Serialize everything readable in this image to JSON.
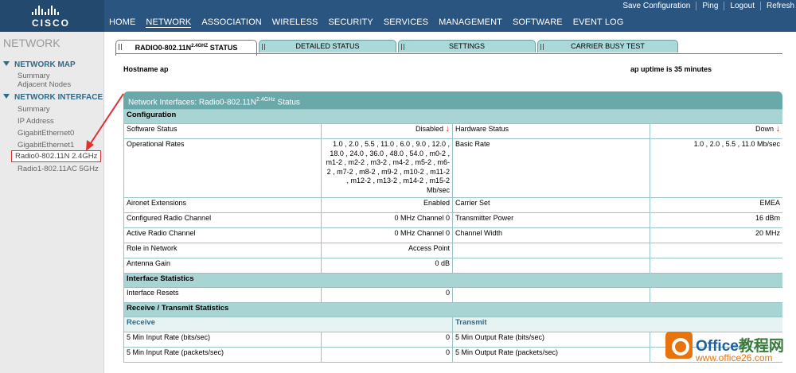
{
  "brand": {
    "logo_text": "CISCO"
  },
  "utility_links": [
    "Save Configuration",
    "Ping",
    "Logout",
    "Refresh"
  ],
  "nav": {
    "items": [
      "HOME",
      "NETWORK",
      "ASSOCIATION",
      "WIRELESS",
      "SECURITY",
      "SERVICES",
      "MANAGEMENT",
      "SOFTWARE",
      "EVENT LOG"
    ],
    "active": "NETWORK"
  },
  "sidebar": {
    "title": "NETWORK",
    "network_map": {
      "label": "NETWORK MAP",
      "items": [
        "Summary",
        "Adjacent Nodes"
      ]
    },
    "network_interface": {
      "label": "NETWORK INTERFACE",
      "items": [
        "Summary",
        "IP Address",
        "GigabitEthernet0",
        "GigabitEthernet1",
        "Radio0-802.11N 2.4GHz",
        "Radio1-802.11AC 5GHz"
      ],
      "selected": "Radio0-802.11N 2.4GHz"
    }
  },
  "tabs": {
    "status": {
      "main": "RADIO0-802.11N",
      "sup": "2.4GHZ",
      "rest": " STATUS"
    },
    "detailed": "DETAILED STATUS",
    "settings": "SETTINGS",
    "carrier": "CARRIER BUSY TEST"
  },
  "info": {
    "hostname": "Hostname  ap",
    "uptime": "ap uptime is 35 minutes"
  },
  "panel": {
    "title_main": "Network Interfaces: Radio0-802.11N",
    "title_sup": "2.4GHz",
    "title_rest": " Status"
  },
  "sections": {
    "configuration": "Configuration",
    "interface_stats": "Interface Statistics",
    "rx_tx": "Receive / Transmit Statistics",
    "receive": "Receive",
    "transmit": "Transmit"
  },
  "config": {
    "software_status": {
      "label": "Software Status",
      "value": "Disabled",
      "arrow": "↓"
    },
    "hardware_status": {
      "label": "Hardware Status",
      "value": "Down",
      "arrow": "↓"
    },
    "operational_rates": {
      "label": "Operational Rates",
      "value": "1.0 , 2.0 , 5.5 , 11.0 , 6.0 , 9.0 , 12.0 , 18.0 , 24.0 , 36.0 , 48.0 , 54.0 , m0-2 , m1-2 , m2-2 , m3-2 , m4-2 , m5-2 , m6-2 , m7-2 , m8-2 , m9-2 , m10-2 , m11-2 , m12-2 , m13-2 , m14-2 , m15-2 Mb/sec"
    },
    "basic_rate": {
      "label": "Basic Rate",
      "value": "1.0 , 2.0 , 5.5 , 11.0 Mb/sec"
    },
    "aironet": {
      "label": "Aironet Extensions",
      "value": "Enabled"
    },
    "carrier_set": {
      "label": "Carrier Set",
      "value": "EMEA"
    },
    "configured_channel": {
      "label": "Configured Radio Channel",
      "value": "0 MHz Channel 0"
    },
    "tx_power": {
      "label": "Transmitter Power",
      "value": "16 dBm"
    },
    "active_channel": {
      "label": "Active Radio Channel",
      "value": "0 MHz Channel 0"
    },
    "channel_width": {
      "label": "Channel Width",
      "value": "20 MHz"
    },
    "role": {
      "label": "Role in Network",
      "value": "Access Point"
    },
    "antenna_gain": {
      "label": "Antenna Gain",
      "value": "0 dB"
    }
  },
  "interface_stats": {
    "resets": {
      "label": "Interface Resets",
      "value": "0"
    }
  },
  "rx_tx": {
    "in_bits": {
      "label": "5 Min Input Rate (bits/sec)",
      "value": "0"
    },
    "in_pkts": {
      "label": "5 Min Input Rate (packets/sec)",
      "value": "0"
    },
    "out_bits": {
      "label": "5 Min Output Rate (bits/sec)",
      "value": ""
    },
    "out_pkts": {
      "label": "5 Min Output Rate (packets/sec)",
      "value": ""
    }
  },
  "watermark": {
    "brand": "Office",
    "brand2": "教程网",
    "url": "www.office26.com"
  },
  "colors": {
    "header": "#2a5580",
    "accent_teal": "#6aa9a9",
    "section_teal": "#a9d4d4",
    "alert_red": "#d02020"
  }
}
